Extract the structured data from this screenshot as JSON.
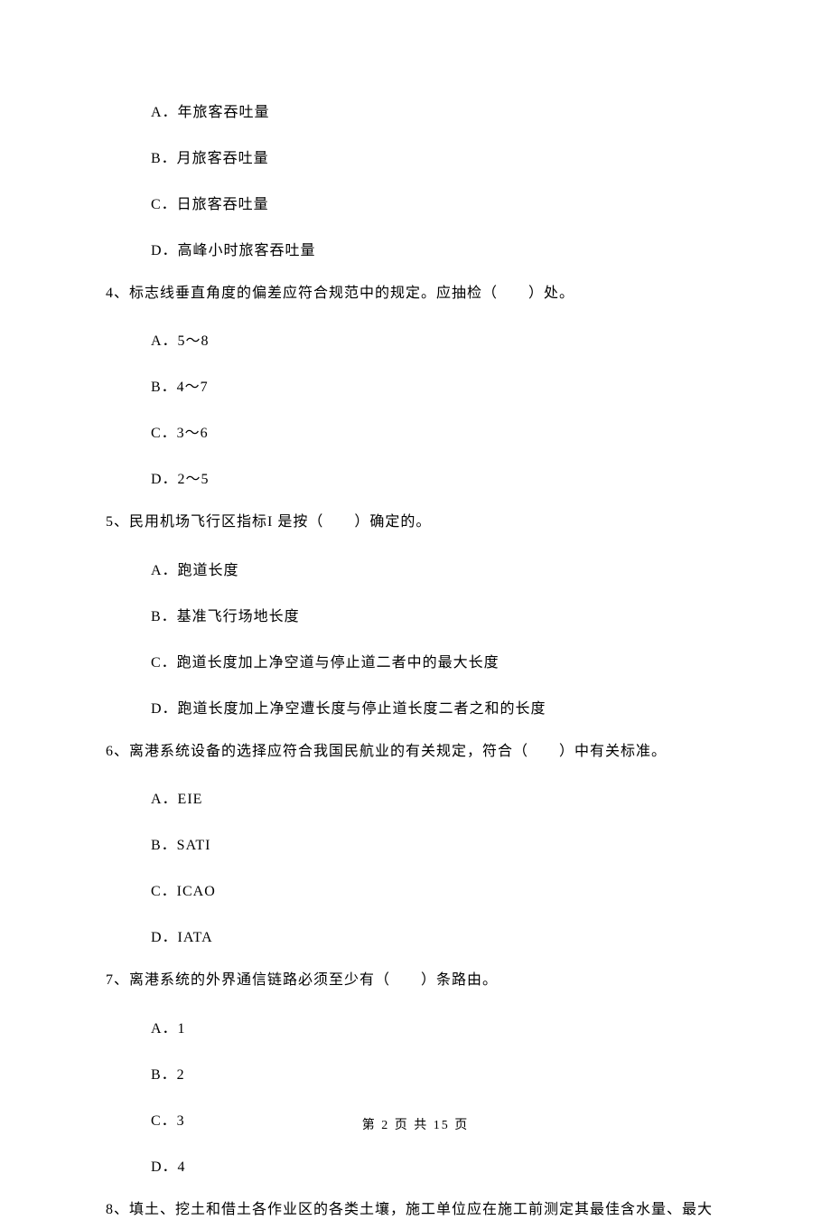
{
  "q3_options": {
    "a": "A．年旅客吞吐量",
    "b": "B．月旅客吞吐量",
    "c": "C．日旅客吞吐量",
    "d": "D．高峰小时旅客吞吐量"
  },
  "q4": {
    "text": "4、标志线垂直角度的偏差应符合规范中的规定。应抽检（　　）处。",
    "a": "A．5～8",
    "b": "B．4～7",
    "c": "C．3～6",
    "d": "D．2～5"
  },
  "q5": {
    "text": "5、民用机场飞行区指标I 是按（　　）确定的。",
    "a": "A．跑道长度",
    "b": "B．基准飞行场地长度",
    "c": "C．跑道长度加上净空道与停止道二者中的最大长度",
    "d": "D．跑道长度加上净空遭长度与停止道长度二者之和的长度"
  },
  "q6": {
    "text": "6、离港系统设备的选择应符合我国民航业的有关规定，符合（　　）中有关标准。",
    "a": "A．EIE",
    "b": "B．SATI",
    "c": "C．ICAO",
    "d": "D．IATA"
  },
  "q7": {
    "text": "7、离港系统的外界通信链路必须至少有（　　）条路由。",
    "a": "A．1",
    "b": "B．2",
    "c": "C．3",
    "d": "D．4"
  },
  "q8": {
    "text": "8、填土、挖土和借土各作业区的各类土壤，施工单位应在施工前测定其最佳含水量、最大"
  },
  "footer": "第 2 页 共 15 页"
}
